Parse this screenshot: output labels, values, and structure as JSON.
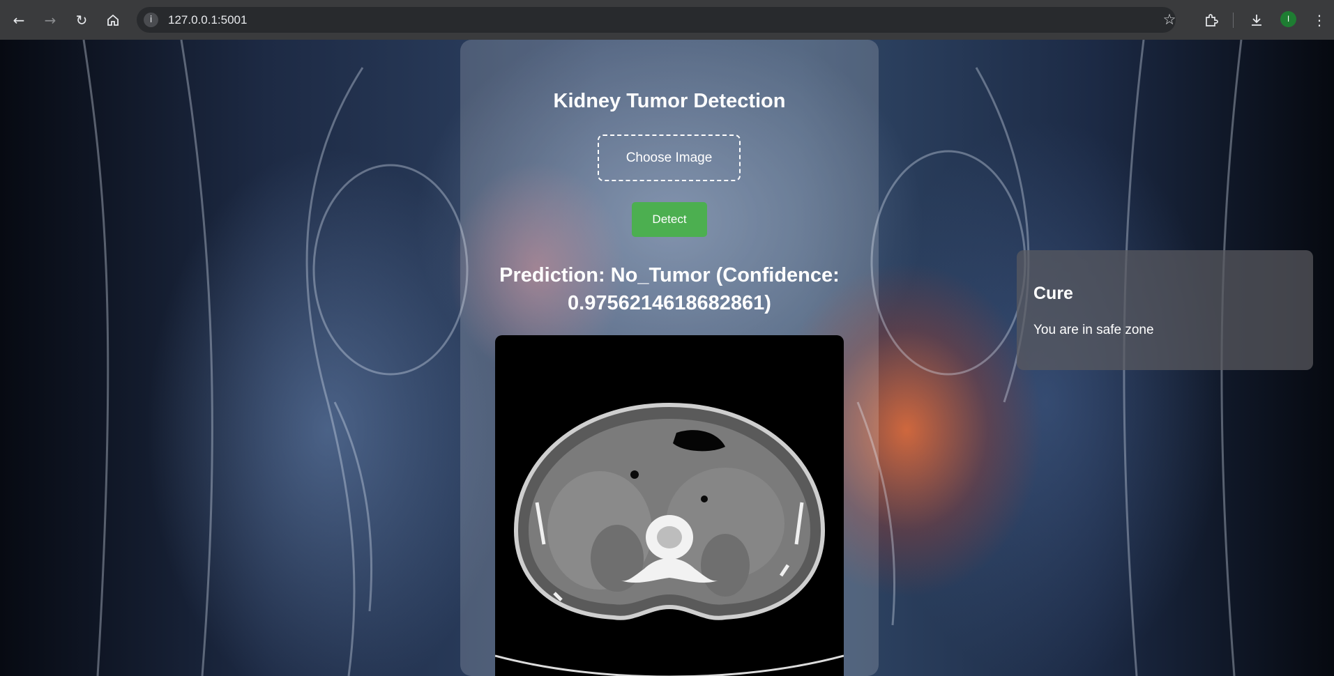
{
  "browser": {
    "url": "127.0.0.1:5001",
    "profile_initial": "I",
    "icons": {
      "back": "arrow-left-icon",
      "forward": "arrow-right-icon",
      "reload": "reload-icon",
      "home": "home-icon",
      "site_info": "info-icon",
      "bookmark": "star-icon",
      "extensions": "puzzle-icon",
      "downloads": "download-icon",
      "menu": "kebab-menu-icon"
    }
  },
  "main": {
    "title": "Kidney Tumor Detection",
    "choose_label": "Choose Image",
    "detect_label": "Detect",
    "prediction": "Prediction: No_Tumor (Confidence: 0.9756214618682861)"
  },
  "cure": {
    "title": "Cure",
    "text": "You are in safe zone"
  },
  "colors": {
    "detect_button": "#4caf50",
    "chrome_bg": "#3a3b3d",
    "avatar": "#1e7d32"
  }
}
